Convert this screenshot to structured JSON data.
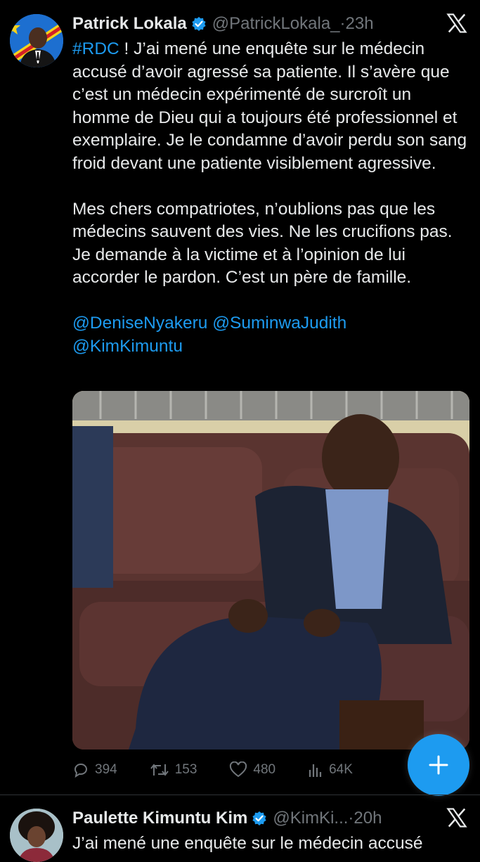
{
  "tweet1": {
    "author_name": "Patrick Lokala",
    "handle": "@PatrickLokala_",
    "separator": "·",
    "time": "23h",
    "hashtag": "#RDC",
    "paragraph1_rest": " ! J’ai mené une enquête sur le médecin accusé d’avoir agressé sa patiente. Il s’avère que c’est un médecin expérimenté de surcroît un homme de Dieu qui a toujours été professionnel et exemplaire. Je le condamne d’avoir perdu son sang froid devant une patiente visiblement agressive.",
    "paragraph2": "Mes chers compatriotes, n’oublions pas que les médecins sauvent des vies. Ne les crucifions pas. Je demande à la victime et à l’opinion de lui accorder le pardon. C’est un père de famille.",
    "mentions": [
      "@DeniseNyakeru",
      "@SuminwaJudith",
      "@KimKimuntu"
    ],
    "stats": {
      "replies": "394",
      "reposts": "153",
      "likes": "480",
      "views": "64K"
    }
  },
  "tweet2": {
    "author_name": "Paulette Kimuntu Kim",
    "handle": "@KimKi...",
    "separator": "·",
    "time": "20h",
    "text": "J’ai mené une enquête sur le médecin accusé"
  },
  "icons": {
    "verified": "verified-badge-icon",
    "x_logo": "x-logo-icon",
    "reply": "reply-icon",
    "repost": "repost-icon",
    "like": "heart-icon",
    "views": "views-icon",
    "compose": "plus-icon"
  },
  "colors": {
    "background": "#000000",
    "text": "#e7e9ea",
    "muted": "#71767b",
    "accent": "#1d9bf0"
  }
}
